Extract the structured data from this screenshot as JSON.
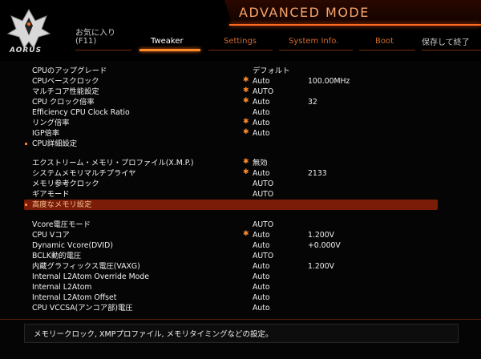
{
  "brand": {
    "logo_text": "AORUS"
  },
  "header": {
    "mode_title": "ADVANCED MODE"
  },
  "tabs": [
    {
      "line1": "お気に入り",
      "line2": "(F11)"
    },
    {
      "line1": "",
      "line2": "Tweaker",
      "active": true
    },
    {
      "line1": "",
      "line2": "Settings"
    },
    {
      "line1": "",
      "line2": "System Info."
    },
    {
      "line1": "",
      "line2": "Boot"
    },
    {
      "line1": "",
      "line2": "保存して終了"
    }
  ],
  "settings": [
    {
      "label": "CPUのアップグレード",
      "value": "デフォルト",
      "value2": "",
      "star": false
    },
    {
      "label": "CPUベースクロック",
      "value": "Auto",
      "value2": "100.00MHz",
      "star": true
    },
    {
      "label": "マルチコア性能設定",
      "value": "AUTO",
      "value2": "",
      "star": true
    },
    {
      "label": "CPU クロック倍率",
      "value": "Auto",
      "value2": "32",
      "star": true
    },
    {
      "label": "Efficiency CPU Clock Ratio",
      "value": "Auto",
      "value2": "",
      "star": false
    },
    {
      "label": "リング倍率",
      "value": "Auto",
      "value2": "",
      "star": true
    },
    {
      "label": "IGP倍率",
      "value": "Auto",
      "value2": "",
      "star": true
    },
    {
      "label": "CPU詳細設定",
      "value": "",
      "value2": "",
      "star": false,
      "bullet": true
    },
    {
      "label": "エクストリーム・メモリ・プロファイル(X.M.P.)",
      "value": "無効",
      "value2": "",
      "star": true
    },
    {
      "label": "システムメモリマルチプライヤ",
      "value": "Auto",
      "value2": "2133",
      "star": true
    },
    {
      "label": "メモリ参考クロック",
      "value": "AUTO",
      "value2": "",
      "star": false
    },
    {
      "label": "ギアモード",
      "value": "AUTO",
      "value2": "",
      "star": false
    },
    {
      "label": "高度なメモリ設定",
      "value": "",
      "value2": "",
      "star": false,
      "bullet": true,
      "highlight": true
    },
    {
      "label": "Vcore電圧モード",
      "value": "AUTO",
      "value2": "",
      "star": false
    },
    {
      "label": "CPU Vコア",
      "value": "Auto",
      "value2": "1.200V",
      "star": true
    },
    {
      "label": "Dynamic Vcore(DVID)",
      "value": "Auto",
      "value2": "+0.000V",
      "star": false
    },
    {
      "label": "BCLK動的電圧",
      "value": "AUTO",
      "value2": "",
      "star": false
    },
    {
      "label": "内蔵グラフィックス電圧(VAXG)",
      "value": "Auto",
      "value2": "1.200V",
      "star": false
    },
    {
      "label": "Internal L2Atom Override Mode",
      "value": "Auto",
      "value2": "",
      "star": false
    },
    {
      "label": "Internal L2Atom",
      "value": "Auto",
      "value2": "",
      "star": false
    },
    {
      "label": "Internal L2Atom Offset",
      "value": "Auto",
      "value2": "",
      "star": false
    },
    {
      "label": "CPU VCCSA(アンコア部)電圧",
      "value": "Auto",
      "value2": "",
      "star": false
    }
  ],
  "footer": {
    "help_text": "メモリークロック, XMPプロファイル, メモリタイミングなどの設定。"
  },
  "colors": {
    "accent": "#ff7a28",
    "highlight_row": "#7a1c08",
    "tab_text": "#d26a2e"
  }
}
